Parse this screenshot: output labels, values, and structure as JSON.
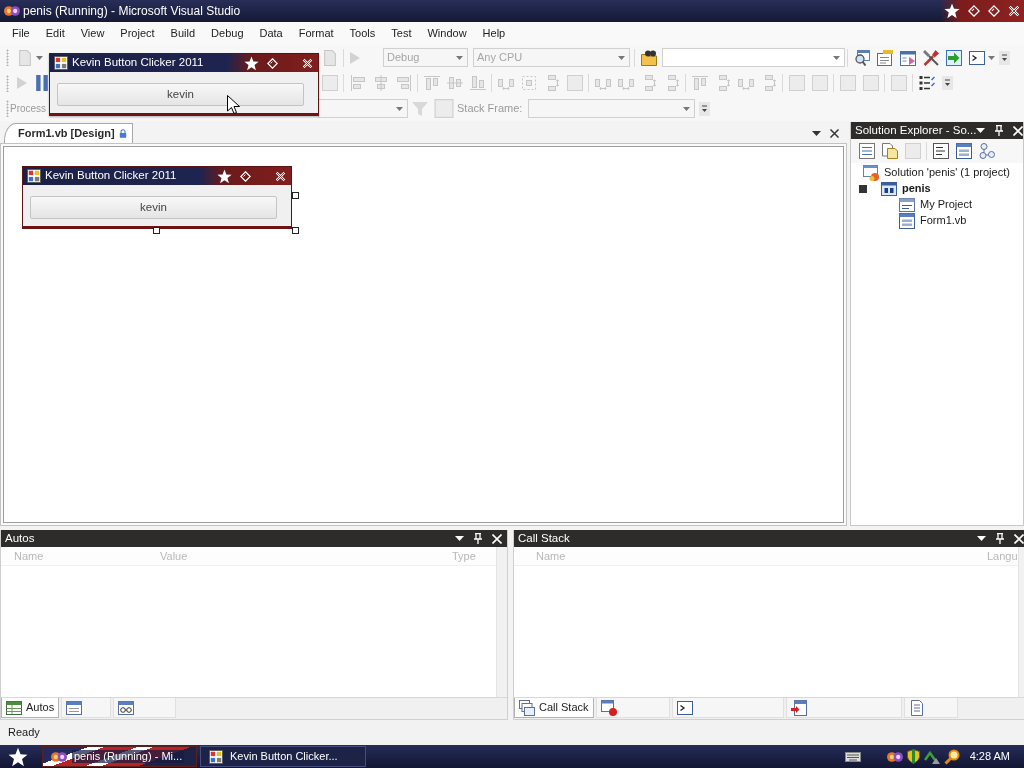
{
  "window": {
    "title": "penis (Running) - Microsoft Visual Studio"
  },
  "menu": [
    "File",
    "Edit",
    "View",
    "Project",
    "Build",
    "Debug",
    "Data",
    "Format",
    "Tools",
    "Test",
    "Window",
    "Help"
  ],
  "toolbar": {
    "configuration": "Debug",
    "platform": "Any CPU",
    "process_label": "Process",
    "stack_frame_label": "Stack Frame:"
  },
  "running_form": {
    "title": "Kevin Button Clicker 2011",
    "button": "kevin"
  },
  "document_tabs": [
    {
      "label": "Form1.vb [Design]",
      "selected": true
    }
  ],
  "designer_form": {
    "title": "Kevin Button Clicker 2011",
    "button": "kevin"
  },
  "solution_explorer": {
    "title": "Solution Explorer - So...",
    "tree": [
      {
        "label": "Solution 'penis' (1 project)",
        "kind": "solution",
        "children": [
          {
            "label": "penis",
            "kind": "project",
            "children": [
              {
                "label": "My Project",
                "kind": "my-project"
              },
              {
                "label": "Form1.vb",
                "kind": "form"
              }
            ]
          }
        ]
      }
    ]
  },
  "autos": {
    "title": "Autos",
    "columns": [
      "Name",
      "Value",
      "Type"
    ]
  },
  "call_stack": {
    "title": "Call Stack",
    "columns": [
      "Name",
      "Langu"
    ]
  },
  "debug_tabs_left": [
    {
      "label": "Autos",
      "kind": "grid",
      "selected": true
    },
    {
      "kind": "window",
      "selected": false
    },
    {
      "kind": "watch",
      "selected": false
    }
  ],
  "debug_tabs_right": [
    {
      "label": "Call Stack",
      "kind": "stack",
      "selected": true
    },
    {
      "kind": "breakpoint",
      "selected": false
    },
    {
      "kind": "console",
      "selected": false
    },
    {
      "kind": "immediate",
      "selected": false
    },
    {
      "kind": "document",
      "selected": false
    }
  ],
  "status_bar": {
    "text": "Ready"
  },
  "taskbar": {
    "buttons": [
      {
        "label": "penis (Running) - Mi...",
        "kind": "ide",
        "selected": true
      },
      {
        "label": "Kevin Button Clicker...",
        "kind": "app",
        "selected": false
      }
    ],
    "clock": "4:28 AM"
  }
}
